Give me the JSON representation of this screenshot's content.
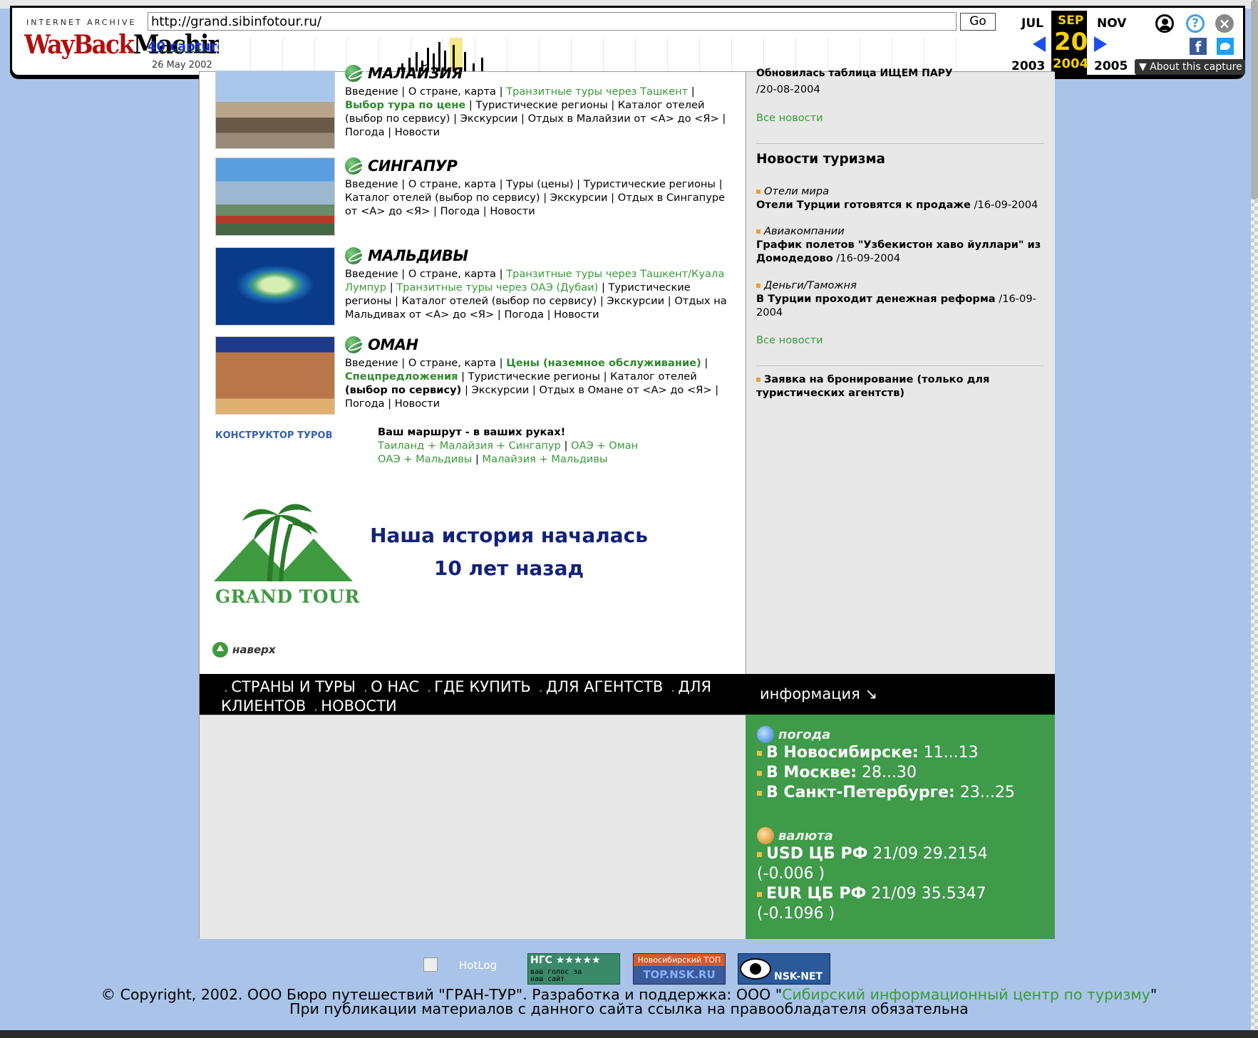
{
  "wayback": {
    "logo_top": "INTERNET ARCHIVE",
    "logo_main_a": "WayBack",
    "logo_main_b": "Machine",
    "url": "http://grand.sibinfotour.ru/",
    "go_label": "Go",
    "captures": "40 capture",
    "first_date": "26 May 2002",
    "month_prev": "JUL",
    "month_cur": "SEP",
    "month_next": "NOV",
    "day_cur": "20",
    "year_prev": "2003",
    "year_cur": "2004",
    "year_next": "2005",
    "about_label": "About this capture",
    "icons": [
      "user-icon",
      "help-icon",
      "close-icon",
      "facebook-icon",
      "twitter-icon"
    ]
  },
  "countries": [
    {
      "name": "МАЛАЙЗИЯ",
      "parts": [
        {
          "t": "Введение | О стране, карта | "
        },
        {
          "t": "Транзитные туры через Ташкент",
          "s": "lk"
        },
        {
          "t": " | "
        },
        {
          "t": "Выбор тура по цене",
          "s": "lkb"
        },
        {
          "t": " | Туристические регионы | Каталог отелей (выбор по сервису) | Экскурсии | Отдых в Малайзии от <А> до <Я> | Погода | Новости"
        }
      ]
    },
    {
      "name": "СИНГАПУР",
      "parts": [
        {
          "t": "Введение | О стране, карта | Туры (цены) | Туристические регионы | Каталог отелей (выбор по сервису) | Экскурсии | Отдых в Сингапуре от <А> до <Я> | Погода | Новости"
        }
      ]
    },
    {
      "name": "МАЛЬДИВЫ",
      "parts": [
        {
          "t": "Введение | О стране, карта | "
        },
        {
          "t": "Транзитные туры через Ташкент/Куала Лумпур",
          "s": "lk"
        },
        {
          "t": " | "
        },
        {
          "t": "Транзитные туры через ОАЭ (Дубаи)",
          "s": "lk"
        },
        {
          "t": " | Туристические регионы | Каталог отелей (выбор по сервису) | Экскурсии | Отдых на Мальдивах от <А> до <Я> | Погода | Новости"
        }
      ]
    },
    {
      "name": "ОМАН",
      "parts": [
        {
          "t": "Введение | О стране, карта | "
        },
        {
          "t": "Цены (наземное обслуживание)",
          "s": "lkb"
        },
        {
          "t": " | "
        },
        {
          "t": "Спецпредложения",
          "s": "lkb"
        },
        {
          "t": " | Туристические регионы | Каталог отелей "
        },
        {
          "t": "(выбор по сервису)",
          "s": "bk"
        },
        {
          "t": " | Экскурсии | Отдых в Омане от <А> до <Я> | Погода | Новости"
        }
      ]
    }
  ],
  "constructor_label": "КОНСТРУКТОР ТУРОВ",
  "route": {
    "title": "Ваш маршрут - в ваших руках!",
    "link1": "Таиланд + Малайзия + Сингапур",
    "link2": "ОАЭ + Оман",
    "link3": "ОАЭ + Мальдивы",
    "link4": "Малайзия + Мальдивы"
  },
  "logo_text": "GRAND TOUR",
  "slogan_1": "Наша история началась",
  "slogan_2": "10 лет назад",
  "up_label": "наверх",
  "news": {
    "top_headline": "Обновилась таблица ИЩЕМ ПАРУ",
    "top_date": "/20-08-2004",
    "all_news": "Все новости",
    "title": "Новости туризма",
    "items": [
      {
        "cat": "Отели мира",
        "headline": "Отели Турции готовятся к продаже",
        "date": " /16-09-2004"
      },
      {
        "cat": "Авиакомпании",
        "headline": "График полетов \"Узбекистон хаво йуллари\" из Домодедово",
        "date": " /16-09-2004"
      },
      {
        "cat": "Деньги/Таможня",
        "headline": "В Турции проходит денежная реформа",
        "date": " /16-09-2004"
      }
    ],
    "booking": "Заявка на бронирование (только для туристических агентств)"
  },
  "nav": {
    "items": [
      "СТРАНЫ И ТУРЫ",
      "О НАС",
      "ГДЕ КУПИТЬ",
      "ДЛЯ АГЕНТСТВ",
      "ДЛЯ КЛИЕНТОВ",
      "НОВОСТИ"
    ],
    "info": "информация ↘"
  },
  "weather": {
    "title": "погода",
    "rows": [
      {
        "city": "В Новосибирске:",
        "val": " 11...13"
      },
      {
        "city": "В Москве:",
        "val": " 28...30"
      },
      {
        "city": "В Санкт-Петербурге:",
        "val": " 23...25"
      }
    ]
  },
  "currency": {
    "title": "валюта",
    "rows": [
      {
        "name": "USD ЦБ РФ",
        "val": " 21/09 29.2154 (-0.006 )"
      },
      {
        "name": "EUR ЦБ РФ",
        "val": " 21/09 35.5347 (-0.1096 )"
      }
    ]
  },
  "badges": {
    "hotlog": "HotLog",
    "ngs_1": "НГС ★★★★★",
    "ngs_2": "ваш голос за наш сайт",
    "top_1": "Новосибирский ТОП",
    "top_2": "TOP.NSK.RU",
    "nsknet": "NSK-NET"
  },
  "footer": {
    "line1_a": "© Copyright, 2002. ООО Бюро путешествий \"ГРАН-ТУР\". Разработка и поддержка: ООО \"",
    "line1_link": "Сибирский информационный центр по туризму",
    "line1_b": "\"",
    "line2": "При публикации материалов с данного сайта ссылка на правообладателя обязательна"
  },
  "colors": {
    "link_green": "#3a9a3a",
    "nav_bg": "#000000",
    "info_bg": "#3f9a4a",
    "page_bg": "#a9c4e8"
  }
}
